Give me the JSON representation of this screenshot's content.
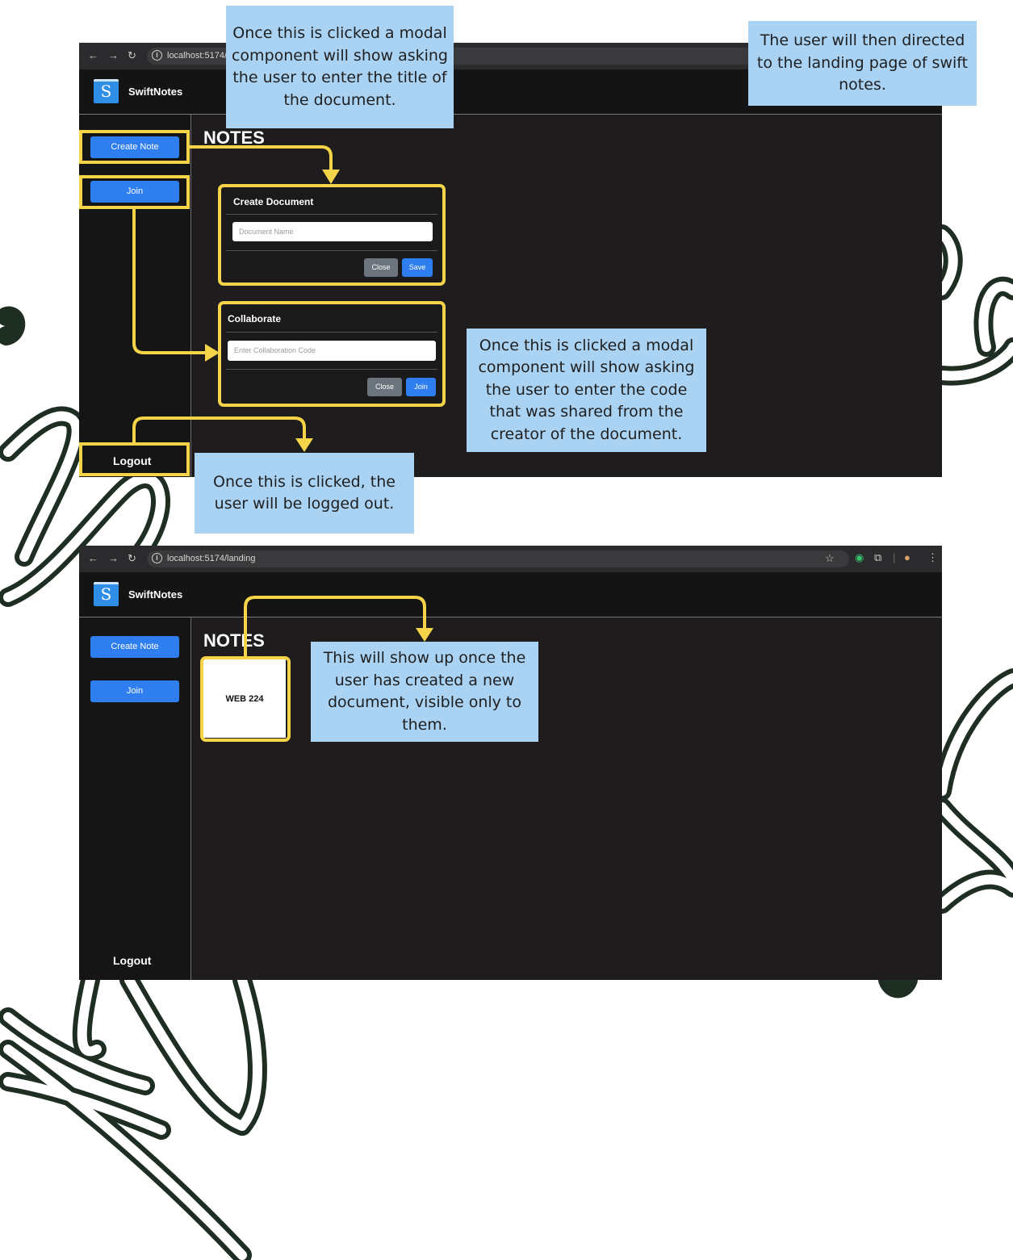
{
  "colors": {
    "accent": "#2f7ef0",
    "highlight": "#f5d449",
    "callout_bg": "#a9d2f3",
    "app_bg": "#1e1c1c",
    "decoration": "#1f2e22"
  },
  "app": {
    "brand": "SwiftNotes",
    "logo_letter": "S",
    "notes_heading": "NOTES"
  },
  "screen1": {
    "url": "localhost:5174/la",
    "sidebar": {
      "create_label": "Create Note",
      "join_label": "Join",
      "logout_label": "Logout"
    },
    "create_modal": {
      "title": "Create Document",
      "input_placeholder": "Document Name",
      "close_label": "Close",
      "save_label": "Save"
    },
    "collab_modal": {
      "title": "Collaborate",
      "input_placeholder": "Enter Collaboration Code",
      "close_label": "Close",
      "join_label": "Join"
    }
  },
  "screen2": {
    "url": "localhost:5174/landing",
    "sidebar": {
      "create_label": "Create Note",
      "join_label": "Join",
      "logout_label": "Logout"
    },
    "document_card": "WEB 224",
    "toolbar_icons": [
      "star-icon",
      "grammarly-icon",
      "extensions-icon",
      "profile-avatar-icon",
      "kebab-menu-icon"
    ]
  },
  "annotations": {
    "create_note": "Once this is clicked a modal component will show asking the user to enter the title of the document.",
    "landing": "The user will then directed to the landing page of swift notes.",
    "join": "Once this is clicked a modal component will show asking the user to enter the code that was shared from the creator of the document.",
    "logout": "Once this is clicked, the user will be logged out.",
    "new_document": "This will show up once the user has created a new document, visible only to them."
  }
}
